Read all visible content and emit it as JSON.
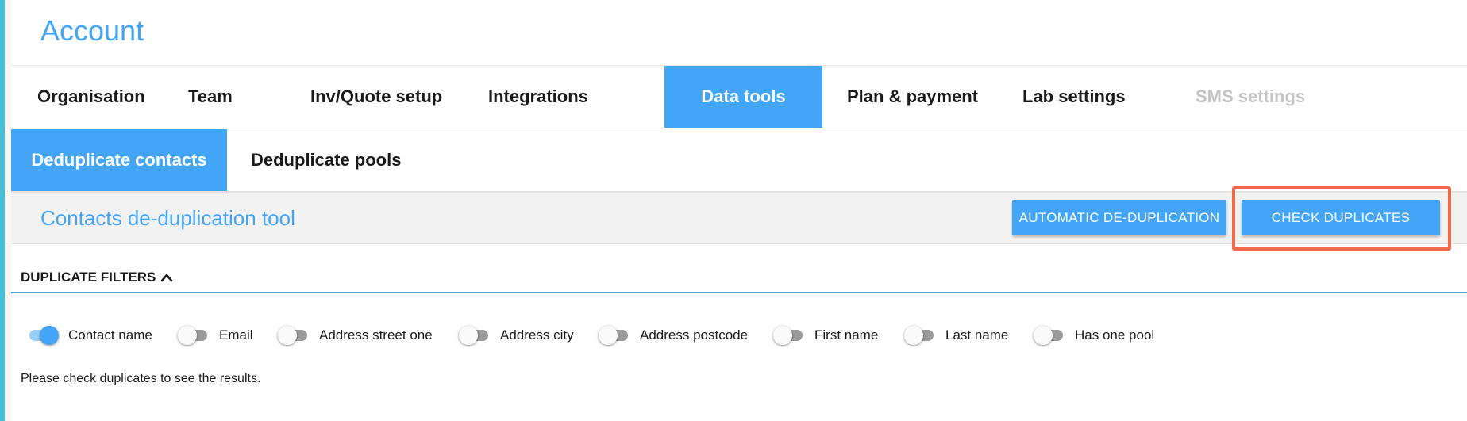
{
  "page": {
    "title": "Account"
  },
  "main_tabs": [
    {
      "label": "Organisation",
      "state": "normal"
    },
    {
      "label": "Team",
      "state": "normal"
    },
    {
      "label": "Inv/Quote setup",
      "state": "normal"
    },
    {
      "label": "Integrations",
      "state": "normal"
    },
    {
      "label": "Data tools",
      "state": "active"
    },
    {
      "label": "Plan & payment",
      "state": "normal"
    },
    {
      "label": "Lab settings",
      "state": "normal"
    },
    {
      "label": "SMS settings",
      "state": "disabled"
    }
  ],
  "sub_tabs": [
    {
      "label": "Deduplicate contacts",
      "state": "active"
    },
    {
      "label": "Deduplicate pools",
      "state": "normal"
    }
  ],
  "toolbar": {
    "title": "Contacts de-duplication tool",
    "auto_button": "AUTOMATIC DE-DUPLICATION",
    "check_button": "CHECK DUPLICATES",
    "highlight_color": "#ef6a4a"
  },
  "filters": {
    "title": "DUPLICATE FILTERS",
    "items": [
      {
        "label": "Contact name",
        "on": true
      },
      {
        "label": "Email",
        "on": false
      },
      {
        "label": "Address street one",
        "on": false
      },
      {
        "label": "Address city",
        "on": false
      },
      {
        "label": "Address postcode",
        "on": false
      },
      {
        "label": "First name",
        "on": false
      },
      {
        "label": "Last name",
        "on": false
      },
      {
        "label": "Has one pool",
        "on": false
      }
    ]
  },
  "results": {
    "note": "Please check duplicates to see the results."
  },
  "colors": {
    "accent": "#42a5f5",
    "toggle_off_track": "#9b9b9b",
    "toggle_on_track": "#9ccff8",
    "disabled_text": "#c4c4c4",
    "left_strip": "#46bfd8"
  }
}
